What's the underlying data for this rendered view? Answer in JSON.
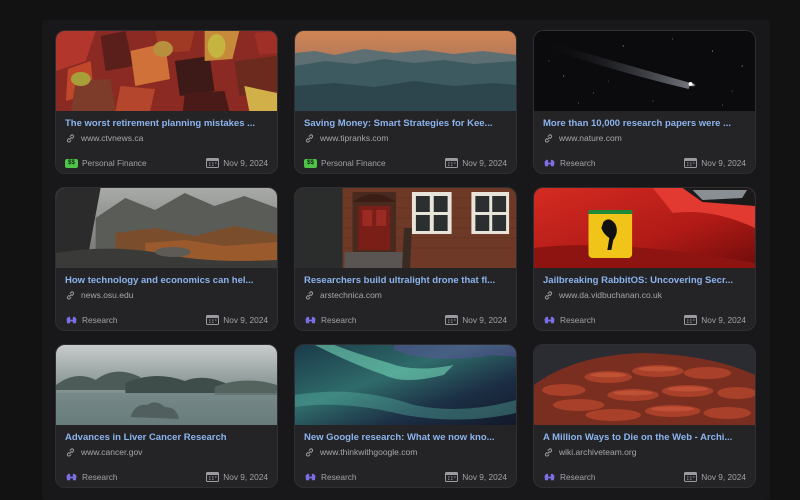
{
  "cards": [
    {
      "title": "The worst retirement planning mistakes ...",
      "url": "www.ctvnews.ca",
      "category": "Personal Finance",
      "category_type": "finance",
      "date": "Nov 9, 2024",
      "image": "abstract-art-red"
    },
    {
      "title": "Saving Money: Smart Strategies for Kee...",
      "url": "www.tipranks.com",
      "category": "Personal Finance",
      "category_type": "finance",
      "date": "Nov 9, 2024",
      "image": "mountain-sunset"
    },
    {
      "title": "More than 10,000 research papers were ...",
      "url": "www.nature.com",
      "category": "Research",
      "category_type": "research",
      "date": "Nov 9, 2024",
      "image": "comet-night-sky"
    },
    {
      "title": "How technology and economics can hel...",
      "url": "news.osu.edu",
      "category": "Research",
      "category_type": "research",
      "date": "Nov 9, 2024",
      "image": "car-window-mountains"
    },
    {
      "title": "Researchers build ultralight drone that fl...",
      "url": "arstechnica.com",
      "category": "Research",
      "category_type": "research",
      "date": "Nov 9, 2024",
      "image": "brick-building"
    },
    {
      "title": "Jailbreaking RabbitOS: Uncovering Secr...",
      "url": "www.da.vidbuchanan.co.uk",
      "category": "Research",
      "category_type": "research",
      "date": "Nov 9, 2024",
      "image": "red-ferrari"
    },
    {
      "title": "Advances in Liver Cancer Research",
      "url": "www.cancer.gov",
      "category": "Research",
      "category_type": "research",
      "date": "Nov 9, 2024",
      "image": "misty-islands"
    },
    {
      "title": "New Google research: What we now kno...",
      "url": "www.thinkwithgoogle.com",
      "category": "Research",
      "category_type": "research",
      "date": "Nov 9, 2024",
      "image": "aurora"
    },
    {
      "title": "A Million Ways to Die on the Web - Archi...",
      "url": "wiki.archiveteam.org",
      "category": "Research",
      "category_type": "research",
      "date": "Nov 9, 2024",
      "image": "red-texture"
    }
  ],
  "icons": {
    "link": "link-icon",
    "finance": "money-icon",
    "research": "binoculars-icon",
    "date": "calendar-icon"
  },
  "colors": {
    "title": "#8cb4ee",
    "card_bg": "#242426",
    "finance_tag": "#4fc24a",
    "research_tag": "#7b6fe6"
  }
}
